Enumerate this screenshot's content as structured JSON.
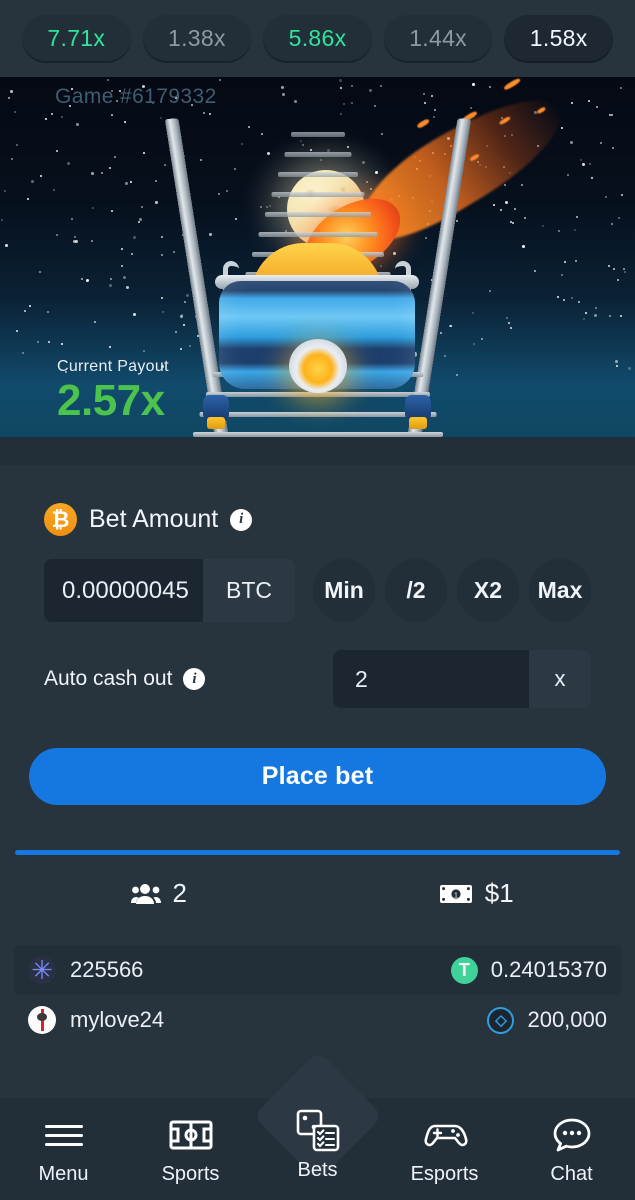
{
  "history": {
    "items": [
      {
        "label": "7.71x",
        "style": "green"
      },
      {
        "label": "1.38x",
        "style": "grey"
      },
      {
        "label": "5.86x",
        "style": "green"
      },
      {
        "label": "1.44x",
        "style": "grey"
      },
      {
        "label": "1.58x",
        "style": "white"
      }
    ]
  },
  "game": {
    "id_label": "Game #6179332",
    "payout_label": "Current Payout",
    "payout_value": "2.57x",
    "payout_color": "#4cc34c",
    "scene": "roller-coaster cart on rails with moon and comet"
  },
  "bet": {
    "currency_icon": "bitcoin-icon",
    "currency_symbol": "₿",
    "title": "Bet Amount",
    "info": "i",
    "amount_value": "0.00000045",
    "amount_currency": "BTC",
    "quick_buttons": [
      "Min",
      "/2",
      "X2",
      "Max"
    ],
    "auto_label": "Auto cash out",
    "auto_value": "2",
    "auto_suffix": "x",
    "place_bet_label": "Place bet",
    "accent_color": "#1478e0"
  },
  "stats": {
    "players_icon": "players-icon",
    "players_count": "2",
    "money_icon": "banknote-icon",
    "money_total": "$1"
  },
  "bets_list": [
    {
      "avatar": "burst-avatar",
      "name": "225566",
      "currency_icon": "usdt-icon",
      "amount": "0.24015370"
    },
    {
      "avatar": "tower-avatar",
      "name": "mylove24",
      "currency_icon": "xrp-icon",
      "amount": "200,000"
    }
  ],
  "nav": {
    "items": [
      {
        "label": "Menu",
        "icon": "hamburger-menu-icon"
      },
      {
        "label": "Sports",
        "icon": "sports-field-icon"
      },
      {
        "label": "Bets",
        "icon": "bets-dice-list-icon"
      },
      {
        "label": "Esports",
        "icon": "gamepad-icon"
      },
      {
        "label": "Chat",
        "icon": "chat-bubble-icon"
      }
    ]
  }
}
